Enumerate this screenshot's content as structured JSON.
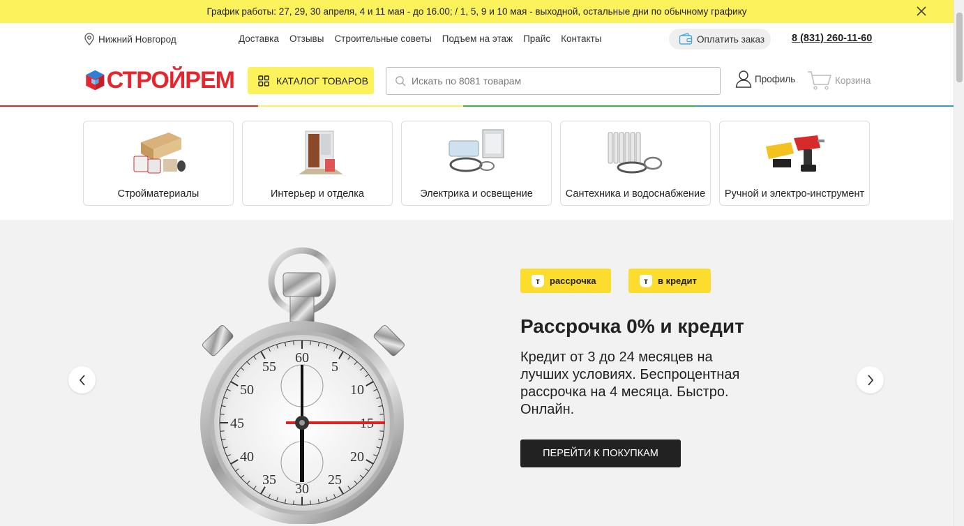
{
  "announcement": {
    "text": "График работы: 27, 29, 30 апреля, 4 и 11 мая - до 16.00; / 1, 5, 9 и 10 мая - выходной, остальные дни по обычному графику"
  },
  "header": {
    "city": "Нижний Новгород",
    "nav": [
      {
        "label": "Доставка"
      },
      {
        "label": "Отзывы"
      },
      {
        "label": "Строительные советы"
      },
      {
        "label": "Подъем на этаж"
      },
      {
        "label": "Прайс"
      },
      {
        "label": "Контакты"
      }
    ],
    "pay_label": "Оплатить заказ",
    "phone": "8 (831) 260-11-60",
    "logo_text": "СТРОЙРЕМ",
    "catalog_label": "КАТАЛОГ ТОВАРОВ",
    "search_placeholder": "Искать по 8081 товарам",
    "profile_label": "Профиль",
    "cart_label": "Корзина"
  },
  "categories": [
    {
      "label": "Стройматериалы"
    },
    {
      "label": "Интерьер и отделка"
    },
    {
      "label": "Электрика и освещение"
    },
    {
      "label": "Сантехника и водоснабжение"
    },
    {
      "label": "Ручной и электро-инструмент"
    }
  ],
  "hero": {
    "badge1": "рассрочка",
    "badge2": "в кредит",
    "badge_logo": "т",
    "title": "Рассрочка 0% и кредит",
    "text": "Кредит от 3 до 24 месяцев на лучших условиях. Беспроцентная рассрочка на 4 месяца. Быстро. Онлайн.",
    "button": "ПЕРЕЙТИ К ПОКУПКАМ",
    "dial": [
      "60",
      "5",
      "10",
      "15",
      "20",
      "25",
      "30",
      "35",
      "40",
      "45",
      "50",
      "55"
    ]
  },
  "colors": {
    "accent_yellow": "#fcf25b",
    "badge_yellow": "#fcdc2c",
    "brand_red": "#e4262e",
    "brand_blue": "#2f7fd6"
  }
}
